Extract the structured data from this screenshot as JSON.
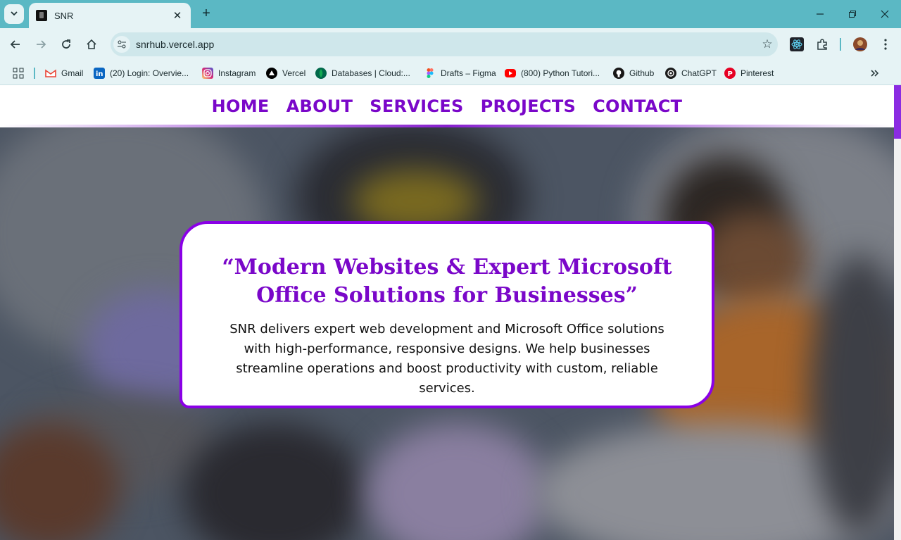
{
  "browser": {
    "tab_title": "SNR",
    "tab_close": "✕",
    "new_tab": "+",
    "url": "snrhub.vercel.app",
    "window_controls": {
      "minimize": "—",
      "restore": "❐",
      "close": "✕"
    }
  },
  "bookmarks": [
    {
      "label": "Gmail",
      "icon": "gmail-icon",
      "color": "#ea4335"
    },
    {
      "label": "(20) Login: Overvie...",
      "icon": "linkedin-icon",
      "color": "#0a66c2"
    },
    {
      "label": "Instagram",
      "icon": "instagram-icon",
      "color": "#d62976"
    },
    {
      "label": "Vercel",
      "icon": "vercel-icon",
      "color": "#000000"
    },
    {
      "label": "Databases | Cloud:...",
      "icon": "mongodb-icon",
      "color": "#00684a"
    },
    {
      "label": "Drafts – Figma",
      "icon": "figma-icon",
      "color": "#a259ff"
    },
    {
      "label": "(800) Python Tutori...",
      "icon": "youtube-icon",
      "color": "#ff0000"
    },
    {
      "label": "Github",
      "icon": "github-icon",
      "color": "#181717"
    },
    {
      "label": "ChatGPT",
      "icon": "chatgpt-icon",
      "color": "#1b1b1b"
    },
    {
      "label": "Pinterest",
      "icon": "pinterest-icon",
      "color": "#e60023"
    }
  ],
  "nav": {
    "items": [
      "HOME",
      "ABOUT",
      "SERVICES",
      "PROJECTS",
      "CONTACT"
    ]
  },
  "hero": {
    "heading": "“Modern Websites & Expert Microsoft Office Solutions for Businesses”",
    "description": "SNR delivers expert web development and Microsoft Office solutions with high-performance, responsive designs. We help businesses streamline operations and boost productivity with custom, reliable services."
  },
  "colors": {
    "accent": "#7a07c9",
    "card_border": "#8a00e6",
    "browser_frame": "#5bb8c4"
  }
}
